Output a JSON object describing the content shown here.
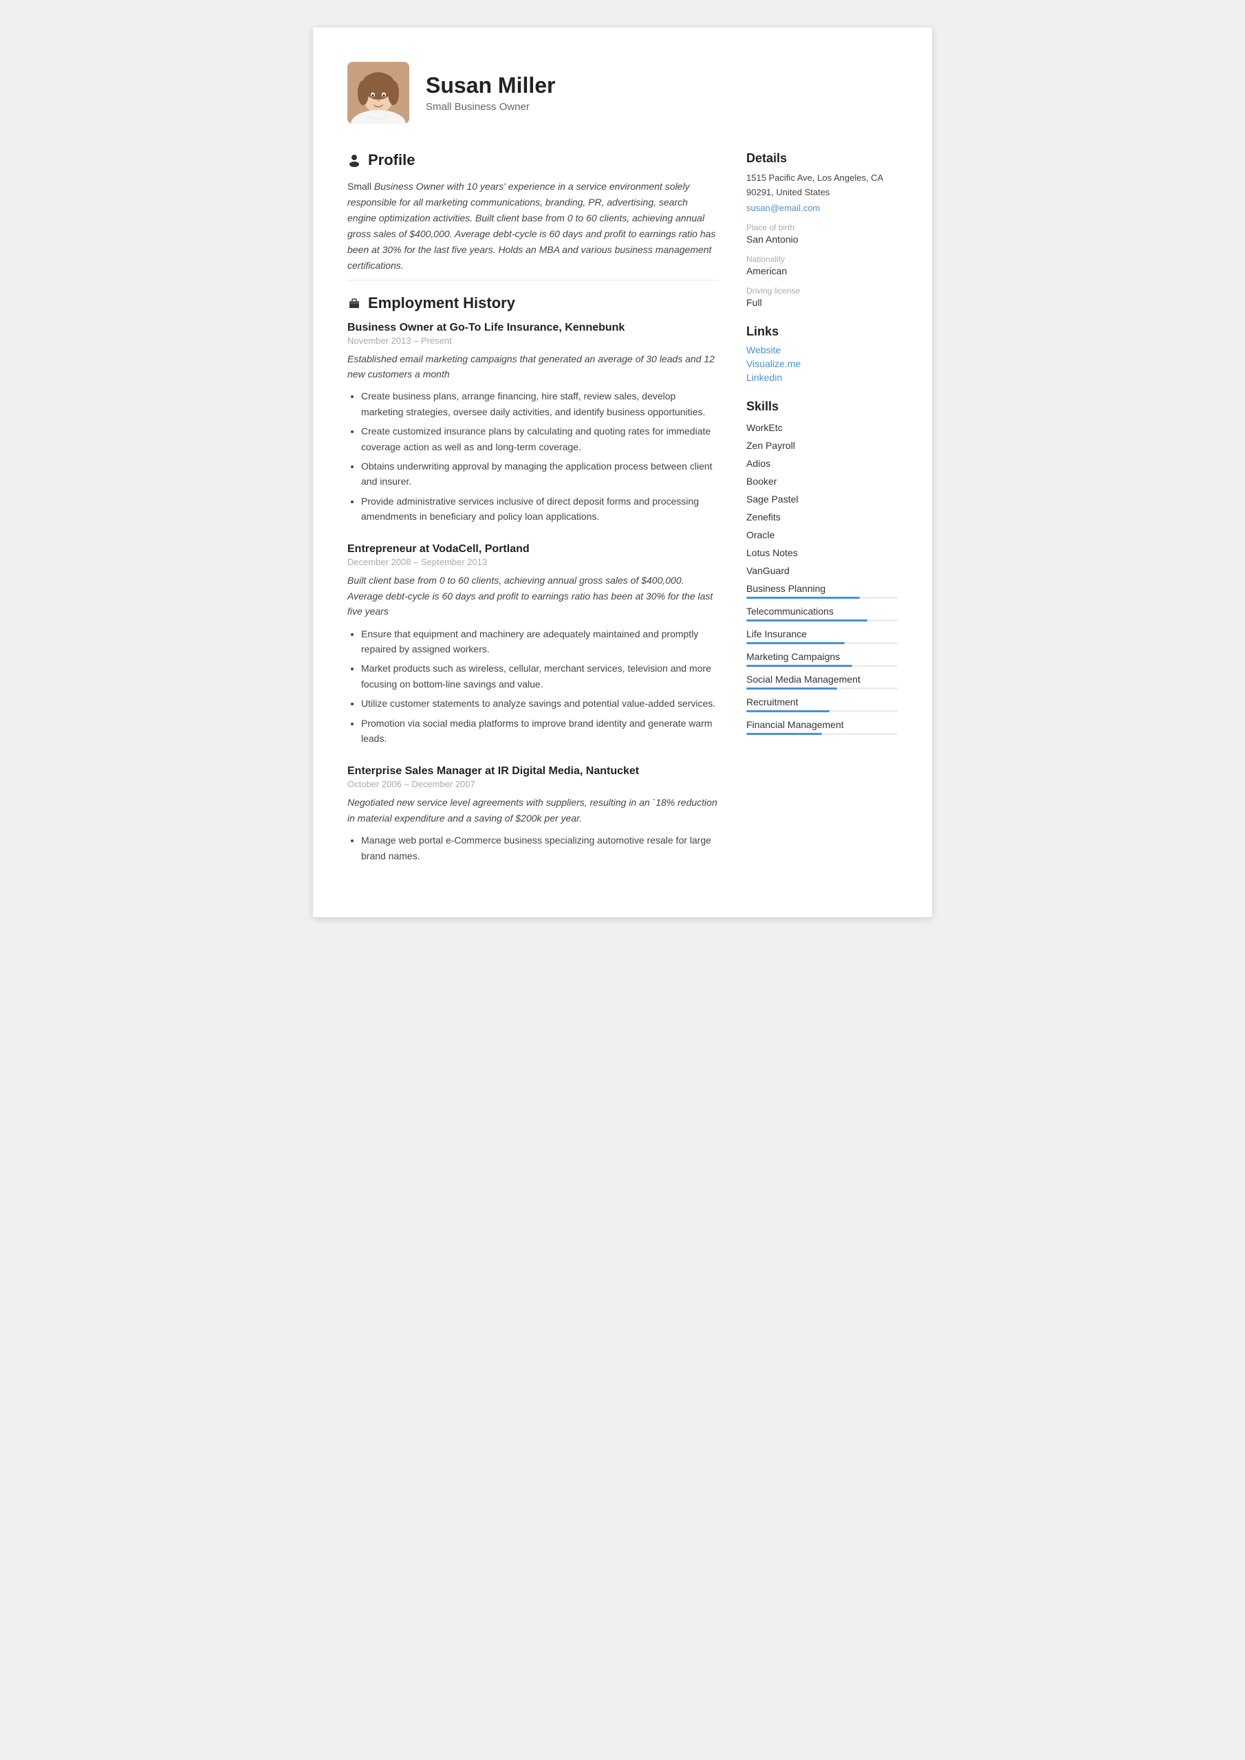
{
  "header": {
    "name": "Susan Miller",
    "subtitle": "Small Business Owner"
  },
  "profile": {
    "section_title": "Profile",
    "text_normal": "Small ",
    "text_italic": "Business Owner with 10 years' experience in a service environment solely responsible for all marketing communications, branding, PR, advertising, search engine optimization activities. Built client base from 0 to 60 clients, achieving annual gross sales of $400,000. Average debt-cycle is 60 days and profit to earnings ratio has been at 30% for the last five years. Holds an MBA and various business management certifications."
  },
  "employment": {
    "section_title": "Employment History",
    "jobs": [
      {
        "title": "Business Owner at Go-To Life Insurance, Kennebunk",
        "date_start": "November 2013",
        "date_sep": "–",
        "date_end": "Present",
        "summary": "Established email marketing campaigns that generated an average of 30 leads and 12 new customers a month",
        "bullets": [
          "Create business plans, arrange financing, hire staff, review sales, develop marketing strategies, oversee daily activities, and identify business opportunities.",
          "Create customized insurance plans by calculating and quoting rates for immediate coverage action as well as and long-term coverage.",
          "Obtains underwriting approval by managing the application process between client and insurer.",
          "Provide administrative services inclusive of direct deposit forms and processing amendments in beneficiary and policy loan applications."
        ]
      },
      {
        "title": "Entrepreneur at VodaCell, Portland",
        "date_start": "December 2008",
        "date_sep": "–",
        "date_end": "September 2013",
        "summary": "Built client base from 0 to 60 clients, achieving annual gross sales of $400,000. Average debt-cycle is 60 days and profit to earnings ratio has been at 30% for the last five years",
        "bullets": [
          "Ensure that equipment and machinery are adequately maintained and promptly repaired by assigned workers.",
          "Market products such as wireless, cellular, merchant services, television and more focusing on bottom-line savings and value.",
          "Utilize customer statements to analyze savings and potential value-added services.",
          "Promotion via social media platforms to improve brand identity and generate warm leads."
        ]
      },
      {
        "title": "Enterprise Sales Manager at IR Digital Media, Nantucket",
        "date_start": "October 2006",
        "date_sep": "–",
        "date_end": "December 2007",
        "summary": "Negotiated new service level agreements with suppliers, resulting in an `18% reduction in material expenditure and a saving of $200k per year.",
        "bullets": [
          "Manage web portal e-Commerce business specializing automotive resale for large brand names."
        ]
      }
    ]
  },
  "details": {
    "section_title": "Details",
    "address": "1515 Pacific Ave, Los Angeles, CA 90291, United States",
    "email": "susan@email.com",
    "place_of_birth_label": "Place of birth",
    "place_of_birth": "San Antonio",
    "nationality_label": "Nationality",
    "nationality": "American",
    "driving_license_label": "Driving license",
    "driving_license": "Full"
  },
  "links": {
    "section_title": "Links",
    "items": [
      {
        "label": "Website"
      },
      {
        "label": "Visualize.me"
      },
      {
        "label": "Linkedin"
      }
    ]
  },
  "skills": {
    "section_title": "Skills",
    "items": [
      {
        "name": "WorkEtc",
        "bar": false
      },
      {
        "name": "Zen Payroll",
        "bar": false
      },
      {
        "name": "Adios",
        "bar": false
      },
      {
        "name": "Booker",
        "bar": false
      },
      {
        "name": "Sage Pastel",
        "bar": false
      },
      {
        "name": "Zenefits",
        "bar": false
      },
      {
        "name": "Oracle",
        "bar": false
      },
      {
        "name": "Lotus Notes",
        "bar": false
      },
      {
        "name": "VanGuard",
        "bar": false
      },
      {
        "name": "Business Planning",
        "bar": true,
        "fill": 75
      },
      {
        "name": "Telecommunications",
        "bar": true,
        "fill": 80
      },
      {
        "name": "Life Insurance",
        "bar": true,
        "fill": 65
      },
      {
        "name": "Marketing Campaigns",
        "bar": true,
        "fill": 70
      },
      {
        "name": "Social Media Management",
        "bar": true,
        "fill": 60
      },
      {
        "name": "Recruitment",
        "bar": true,
        "fill": 55
      },
      {
        "name": "Financial Management",
        "bar": true,
        "fill": 50
      }
    ]
  }
}
